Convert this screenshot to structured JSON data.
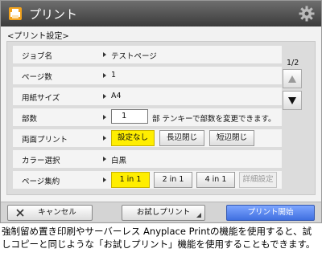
{
  "titlebar": {
    "title": "プリント"
  },
  "subtitle": "<プリント設定>",
  "settings": {
    "job_name": {
      "label": "ジョブ名",
      "value": "テストページ"
    },
    "pages": {
      "label": "ページ数",
      "value": "1"
    },
    "paper_size": {
      "label": "用紙サイズ",
      "value": "A4"
    },
    "copies": {
      "label": "部数",
      "value": "1",
      "unit_text": "部 テンキーで部数を変更できます。"
    },
    "duplex": {
      "label": "両面プリント",
      "options": [
        "設定なし",
        "長辺閉じ",
        "短辺閉じ"
      ],
      "selected": "設定なし"
    },
    "color": {
      "label": "カラー選択",
      "value": "白黒"
    },
    "nup": {
      "label": "ページ集約",
      "options": [
        "1 in 1",
        "2 in 1",
        "4 in 1"
      ],
      "detail": "詳細設定",
      "selected": "1 in 1"
    }
  },
  "pager": {
    "label": "1/2"
  },
  "bottom": {
    "cancel": "キャンセル",
    "trial": "お試しプリント",
    "start": "プリント開始"
  },
  "caption": "強制留め置き印刷やサーバーレス Anyplace Printの機能を使用すると、試しコピーと同じような「お試しプリント」機能を使用することもできます。",
  "colors": {
    "selected": "#ffee00",
    "start_button": "#3f6fe0",
    "titlebar": "#4a4a4a"
  }
}
